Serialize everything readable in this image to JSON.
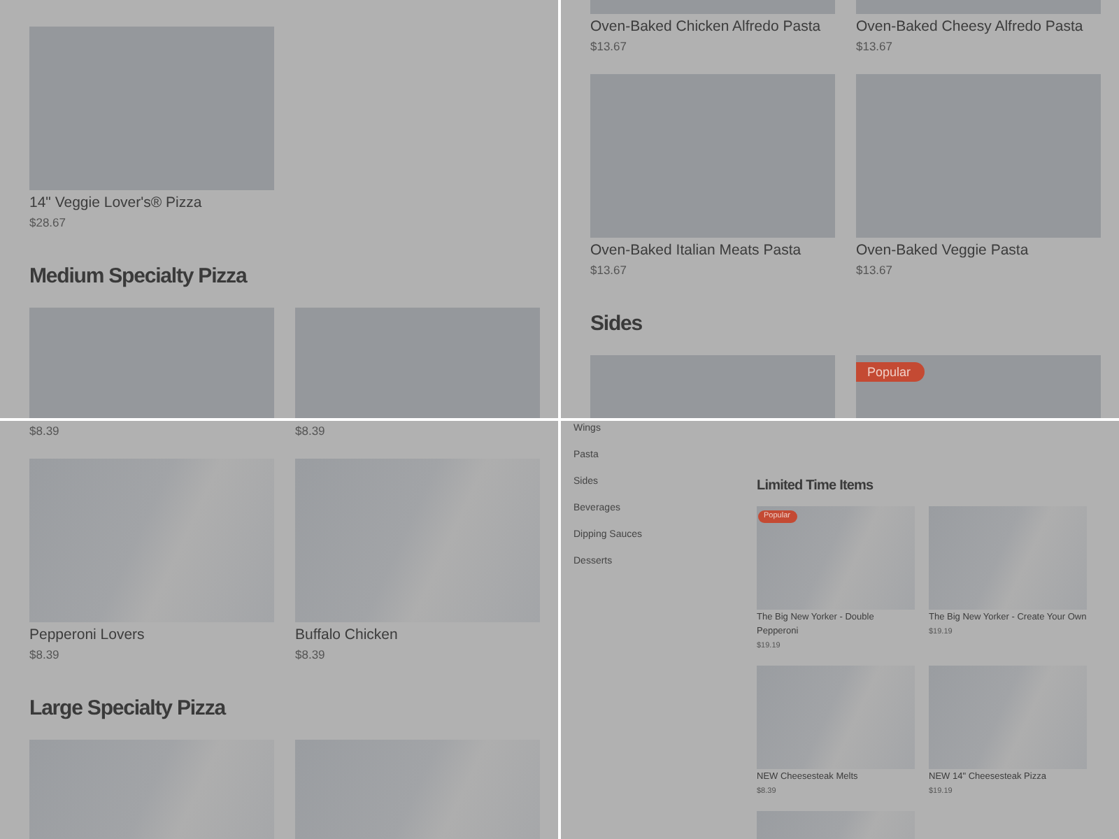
{
  "panels": [
    {
      "kind": "menu",
      "blocks": [
        {
          "kind": "grid",
          "cards": [
            {
              "kind": "card",
              "name": "14\" Veggie Lover's® Pizza",
              "price": "$28.67"
            }
          ]
        },
        {
          "kind": "heading",
          "text": "Medium Specialty Pizza"
        },
        {
          "kind": "grid",
          "cards": [
            {
              "kind": "card"
            },
            {
              "kind": "card"
            }
          ]
        }
      ]
    },
    {
      "kind": "menu",
      "blocks": [
        {
          "kind": "grid",
          "cards": [
            {
              "kind": "cut",
              "name": "Oven-Baked Chicken Alfredo Pasta",
              "price": "$13.67"
            },
            {
              "kind": "cut",
              "name": "Oven-Baked Cheesy Alfredo Pasta",
              "price": "$13.67"
            }
          ]
        },
        {
          "kind": "grid",
          "cards": [
            {
              "kind": "card",
              "name": "Oven-Baked Italian Meats Pasta",
              "price": "$13.67"
            },
            {
              "kind": "card",
              "name": "Oven-Baked Veggie Pasta",
              "price": "$13.67"
            }
          ]
        },
        {
          "kind": "heading",
          "text": "Sides"
        },
        {
          "kind": "grid",
          "cards": [
            {
              "kind": "card"
            },
            {
              "kind": "card",
              "badge": "Popular"
            }
          ]
        }
      ]
    },
    {
      "kind": "menu",
      "blocks": [
        {
          "kind": "grid",
          "cards": [
            {
              "kind": "text",
              "price": "$8.39"
            },
            {
              "kind": "text",
              "price": "$8.39"
            }
          ]
        },
        {
          "kind": "grid",
          "cards": [
            {
              "kind": "card",
              "name": "Pepperoni Lovers",
              "price": "$8.39"
            },
            {
              "kind": "card",
              "name": "Buffalo Chicken",
              "price": "$8.39"
            }
          ]
        },
        {
          "kind": "heading",
          "text": "Large Specialty Pizza"
        },
        {
          "kind": "grid",
          "cards": [
            {
              "kind": "card"
            },
            {
              "kind": "card"
            }
          ]
        }
      ]
    },
    {
      "kind": "menu-with-sidebar",
      "sidebar": {
        "items": [
          {
            "label": "Wings"
          },
          {
            "label": "Pasta"
          },
          {
            "label": "Sides"
          },
          {
            "label": "Beverages"
          },
          {
            "label": "Dipping Sauces"
          },
          {
            "label": "Desserts"
          }
        ]
      },
      "blocks": [
        {
          "kind": "heading",
          "text": "Limited Time Items"
        },
        {
          "kind": "grid",
          "cards": [
            {
              "kind": "card",
              "badge": "Popular",
              "name": "The Big New Yorker - Double Pepperoni",
              "price": "$19.19"
            },
            {
              "kind": "card",
              "name": "The Big New Yorker - Create Your Own",
              "price": "$19.19"
            }
          ]
        },
        {
          "kind": "grid",
          "cards": [
            {
              "kind": "card",
              "name": "NEW Cheesesteak Melts",
              "price": "$8.39"
            },
            {
              "kind": "card",
              "name": "NEW 14\" Cheesesteak Pizza",
              "price": "$19.19"
            }
          ]
        },
        {
          "kind": "grid",
          "cards": [
            {
              "kind": "card"
            }
          ]
        }
      ]
    }
  ]
}
